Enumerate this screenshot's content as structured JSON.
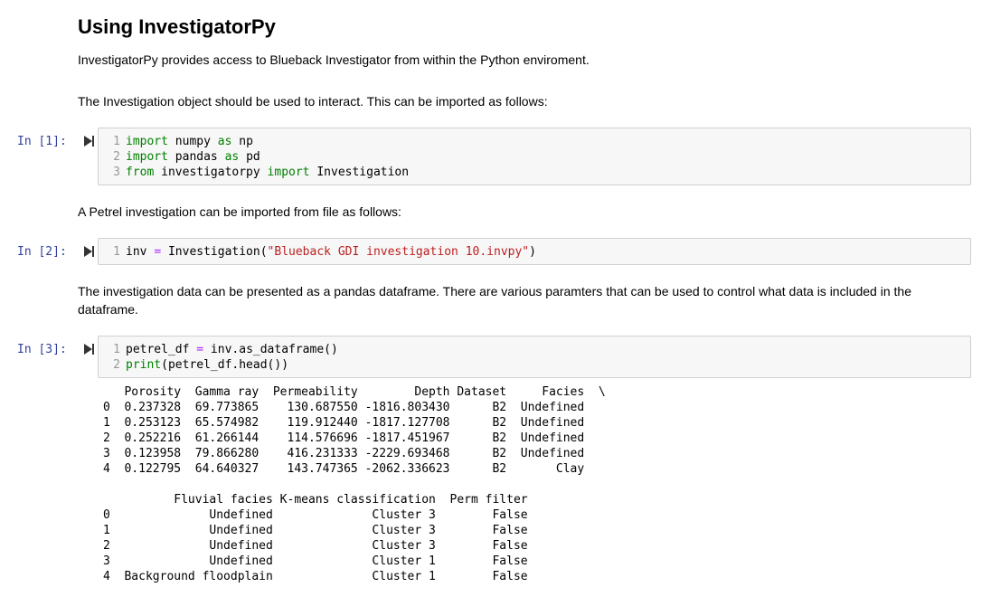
{
  "heading": "Using InvestigatorPy",
  "intro_text": "InvestigatorPy provides access to Blueback Investigator from within the Python enviroment.",
  "import_text": "The Investigation object should be used to interact. This can be imported as follows:",
  "petrel_text": "A Petrel investigation can be imported from file as follows:",
  "dataframe_text_1": "The investigation data can be presented as a pandas dataframe. There are various paramters that can be used to control what data is included in the",
  "dataframe_text_2": "dataframe.",
  "cells": [
    {
      "prompt": "In [1]:",
      "line_numbers": [
        "1",
        "2",
        "3"
      ],
      "code": {
        "l1_kw": "import",
        "l1_mod": " numpy ",
        "l1_as": "as",
        "l1_alias": " np",
        "l2_kw": "import",
        "l2_mod": " pandas ",
        "l2_as": "as",
        "l2_alias": " pd",
        "l3_from": "from",
        "l3_mod": " investigatorpy ",
        "l3_import": "import",
        "l3_name": " Investigation"
      }
    },
    {
      "prompt": "In [2]:",
      "line_numbers": [
        "1"
      ],
      "code": {
        "l1_var": "inv ",
        "l1_eq": "=",
        "l1_call": " Investigation(",
        "l1_str": "\"Blueback GDI investigation 10.invpy\"",
        "l1_close": ")"
      }
    },
    {
      "prompt": "In [3]:",
      "line_numbers": [
        "1",
        "2"
      ],
      "code": {
        "l1_var": "petrel_df ",
        "l1_eq": "=",
        "l1_call": " inv.as_dataframe()",
        "l2_print": "print",
        "l2_args": "(petrel_df.head())"
      },
      "output": "   Porosity  Gamma ray  Permeability        Depth Dataset     Facies  \\\n0  0.237328  69.773865    130.687550 -1816.803430      B2  Undefined   \n1  0.253123  65.574982    119.912440 -1817.127708      B2  Undefined   \n2  0.252216  61.266144    114.576696 -1817.451967      B2  Undefined   \n3  0.123958  79.866280    416.231333 -2229.693468      B2  Undefined   \n4  0.122795  64.640327    143.747365 -2062.336623      B2       Clay   \n\n          Fluvial facies K-means classification  Perm filter  \n0              Undefined              Cluster 3        False  \n1              Undefined              Cluster 3        False  \n2              Undefined              Cluster 3        False  \n3              Undefined              Cluster 1        False  \n4  Background floodplain              Cluster 1        False  "
    }
  ],
  "icons": {
    "run": "run-cell-icon"
  },
  "colors": {
    "prompt": "#303f9f",
    "keyword": "#008000",
    "operator": "#aa22ff",
    "string": "#ba2121",
    "cell_bg": "#f7f7f7",
    "cell_border": "#cfcfcf"
  }
}
